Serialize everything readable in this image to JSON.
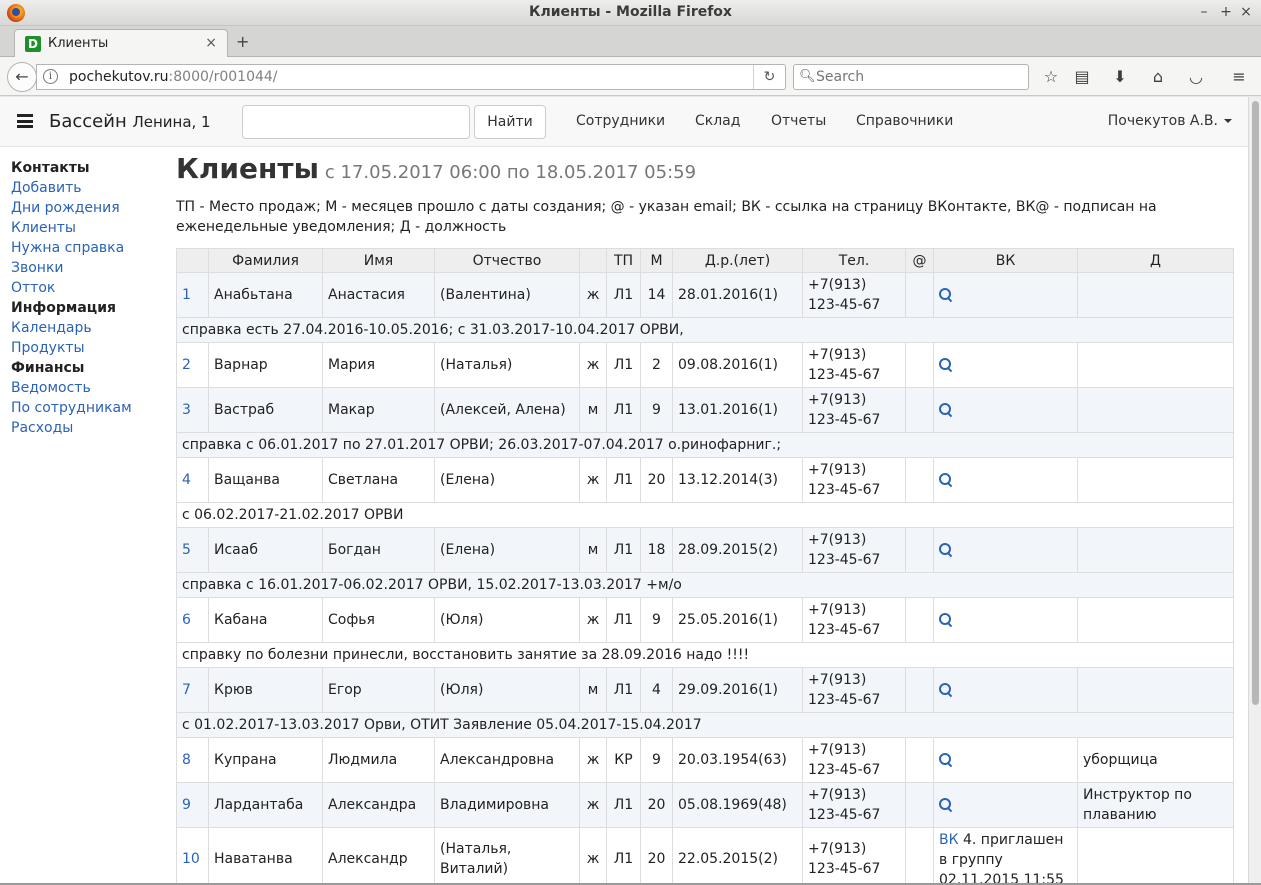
{
  "window": {
    "title": "Клиенты - Mozilla Firefox"
  },
  "tab": {
    "label": "Клиенты",
    "favicon_letter": "D"
  },
  "browser": {
    "url_host": "pochekutov.ru",
    "url_rest": ":8000/r001044/",
    "search_placeholder": "Search"
  },
  "app": {
    "brand": "Бассейн",
    "brand_sub": "Ленина, 1",
    "find_label": "Найти",
    "menu": [
      "Сотрудники",
      "Склад",
      "Отчеты",
      "Справочники"
    ],
    "user": "Почекутов А.В."
  },
  "sidebar": {
    "items": [
      {
        "label": "Контакты",
        "type": "head"
      },
      {
        "label": "Добавить",
        "type": "link"
      },
      {
        "label": "Дни рождения",
        "type": "link"
      },
      {
        "label": "Клиенты",
        "type": "link"
      },
      {
        "label": "Нужна справка",
        "type": "link"
      },
      {
        "label": "Звонки",
        "type": "link"
      },
      {
        "label": "Отток",
        "type": "link"
      },
      {
        "label": "Информация",
        "type": "head"
      },
      {
        "label": "Календарь",
        "type": "link"
      },
      {
        "label": "Продукты",
        "type": "link"
      },
      {
        "label": "Финансы",
        "type": "head"
      },
      {
        "label": "Ведомость",
        "type": "link"
      },
      {
        "label": "По сотрудникам",
        "type": "link"
      },
      {
        "label": "Расходы",
        "type": "link"
      }
    ]
  },
  "page": {
    "title": "Клиенты",
    "range": "с 17.05.2017 06:00 по 18.05.2017 05:59",
    "legend": "ТП - Место продаж; М - месяцев прошло с даты создания; @ - указан email; ВК - ссылка на страницу ВКонтакте, ВК@ - подписан на еженедельные уведомления; Д - должность"
  },
  "table": {
    "columns": [
      "",
      "Фамилия",
      "Имя",
      "Отчество",
      "",
      "ТП",
      "М",
      "Д.р.(лет)",
      "Тел.",
      "@",
      "ВК",
      "Д"
    ],
    "rows": [
      {
        "n": "1",
        "last": "Анабьтана",
        "first": "Анастасия",
        "middle": "(Валентина)",
        "sex": "ж",
        "tp": "Л1",
        "m": "14",
        "dob": "28.01.2016(1)",
        "phone": "+7(913)",
        "phone2": "123-45-67",
        "email": "",
        "vk": "search",
        "vk_text": "",
        "pos": "",
        "note": "справка есть 27.04.2016-10.05.2016; с 31.03.2017-10.04.2017 ОРВИ,"
      },
      {
        "n": "2",
        "last": "Варнар",
        "first": "Мария",
        "middle": "(Наталья)",
        "sex": "ж",
        "tp": "Л1",
        "m": "2",
        "dob": "09.08.2016(1)",
        "phone": "+7(913)",
        "phone2": "123-45-67",
        "email": "",
        "vk": "search",
        "vk_text": "",
        "pos": "",
        "note": ""
      },
      {
        "n": "3",
        "last": "Вастраб",
        "first": "Макар",
        "middle": "(Алексей, Алена)",
        "sex": "м",
        "tp": "Л1",
        "m": "9",
        "dob": "13.01.2016(1)",
        "phone": "+7(913)",
        "phone2": "123-45-67",
        "email": "",
        "vk": "search",
        "vk_text": "",
        "pos": "",
        "note": "справка с 06.01.2017 по 27.01.2017 ОРВИ; 26.03.2017-07.04.2017 о.ринофарниг.;"
      },
      {
        "n": "4",
        "last": "Ващанва",
        "first": "Светлана",
        "middle": "(Елена)",
        "sex": "ж",
        "tp": "Л1",
        "m": "20",
        "dob": "13.12.2014(3)",
        "phone": "+7(913)",
        "phone2": "123-45-67",
        "email": "",
        "vk": "search",
        "vk_text": "",
        "pos": "",
        "note": "с 06.02.2017-21.02.2017 ОРВИ"
      },
      {
        "n": "5",
        "last": "Исааб",
        "first": "Богдан",
        "middle": "(Елена)",
        "sex": "м",
        "tp": "Л1",
        "m": "18",
        "dob": "28.09.2015(2)",
        "phone": "+7(913)",
        "phone2": "123-45-67",
        "email": "",
        "vk": "search",
        "vk_text": "",
        "pos": "",
        "note": "справка с 16.01.2017-06.02.2017 ОРВИ, 15.02.2017-13.03.2017 +м/о"
      },
      {
        "n": "6",
        "last": "Кабана",
        "first": "Софья",
        "middle": "(Юля)",
        "sex": "ж",
        "tp": "Л1",
        "m": "9",
        "dob": "25.05.2016(1)",
        "phone": "+7(913)",
        "phone2": "123-45-67",
        "email": "",
        "vk": "search",
        "vk_text": "",
        "pos": "",
        "note": "справку по болезни принесли, восстановить занятие за 28.09.2016 надо !!!!"
      },
      {
        "n": "7",
        "last": "Крюв",
        "first": "Егор",
        "middle": "(Юля)",
        "sex": "м",
        "tp": "Л1",
        "m": "4",
        "dob": "29.09.2016(1)",
        "phone": "+7(913)",
        "phone2": "123-45-67",
        "email": "",
        "vk": "search",
        "vk_text": "",
        "pos": "",
        "note": "с 01.02.2017-13.03.2017 Орви, ОТИТ Заявление 05.04.2017-15.04.2017"
      },
      {
        "n": "8",
        "last": "Купрана",
        "first": "Людмила",
        "middle": "Александровна",
        "sex": "ж",
        "tp": "КР",
        "m": "9",
        "dob": "20.03.1954(63)",
        "phone": "+7(913)",
        "phone2": "123-45-67",
        "email": "",
        "vk": "search",
        "vk_text": "",
        "pos": "уборщица",
        "note": ""
      },
      {
        "n": "9",
        "last": "Лардантаба",
        "first": "Александра",
        "middle": "Владимировна",
        "sex": "ж",
        "tp": "Л1",
        "m": "20",
        "dob": "05.08.1969(48)",
        "phone": "+7(913)",
        "phone2": "123-45-67",
        "email": "",
        "vk": "search",
        "vk_text": "",
        "pos": "Инструктор по плаванию",
        "note": ""
      },
      {
        "n": "10",
        "last": "Наватанва",
        "first": "Александр",
        "middle": "(Наталья, Виталий)",
        "sex": "ж",
        "tp": "Л1",
        "m": "20",
        "dob": "22.05.2015(2)",
        "phone": "+7(913)",
        "phone2": "123-45-67",
        "email": "",
        "vk": "link",
        "vk_link": "ВК",
        "vk_text": "4. приглашен в группу 02.11.2015 11:55",
        "pos": "",
        "note": ""
      }
    ]
  }
}
